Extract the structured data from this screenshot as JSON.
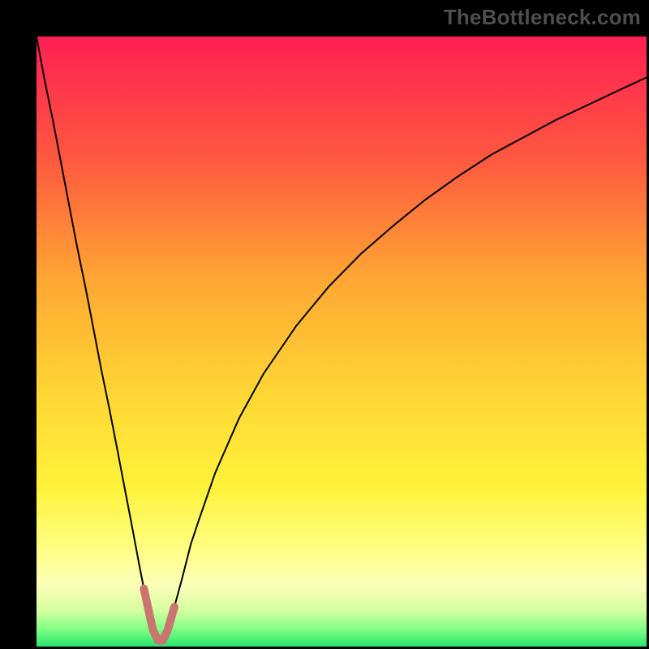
{
  "watermark": "TheBottleneck.com",
  "chart_data": {
    "type": "line",
    "title": "",
    "xlabel": "",
    "ylabel": "",
    "xlim": [
      0,
      100
    ],
    "ylim": [
      0,
      100
    ],
    "grid": false,
    "legend": false,
    "background_gradient": {
      "stops": [
        {
          "pos": 0.0,
          "color": "#ff1f53"
        },
        {
          "pos": 0.2,
          "color": "#ff5840"
        },
        {
          "pos": 0.4,
          "color": "#ffa733"
        },
        {
          "pos": 0.58,
          "color": "#ffd534"
        },
        {
          "pos": 0.74,
          "color": "#fff23b"
        },
        {
          "pos": 0.84,
          "color": "#ffff84"
        },
        {
          "pos": 0.9,
          "color": "#fbffb8"
        },
        {
          "pos": 0.94,
          "color": "#d6ffa0"
        },
        {
          "pos": 0.97,
          "color": "#86ff86"
        },
        {
          "pos": 1.0,
          "color": "#27e56b"
        }
      ]
    },
    "series": [
      {
        "name": "bottleneck-curve",
        "color": "#000000",
        "width": 2,
        "x": [
          0.0,
          1.3,
          2.7,
          4.0,
          5.3,
          6.6,
          8.0,
          9.3,
          10.6,
          12.0,
          13.3,
          14.6,
          15.6,
          16.8,
          17.6,
          18.6,
          19.1,
          19.9,
          20.7,
          21.5,
          22.6,
          23.9,
          25.3,
          26.6,
          29.3,
          33.2,
          37.2,
          42.6,
          47.9,
          53.2,
          58.5,
          63.8,
          69.0,
          74.5,
          79.7,
          85.1,
          90.4,
          95.7,
          100.0
        ],
        "y": [
          100.0,
          93.0,
          86.2,
          79.4,
          72.6,
          65.8,
          59.0,
          52.3,
          45.5,
          38.7,
          32.0,
          25.2,
          20.0,
          13.6,
          9.5,
          4.9,
          2.7,
          1.0,
          1.0,
          2.7,
          6.5,
          11.3,
          16.8,
          20.7,
          28.5,
          37.4,
          44.7,
          52.6,
          59.0,
          64.4,
          69.0,
          73.3,
          77.0,
          80.6,
          83.4,
          86.3,
          88.8,
          91.3,
          93.3
        ]
      },
      {
        "name": "bottleneck-highlight",
        "color": "#c9746f",
        "width": 10,
        "linecap": "round",
        "x": [
          17.6,
          18.6,
          19.1,
          19.9,
          20.7,
          21.5,
          22.6
        ],
        "y": [
          9.5,
          4.9,
          2.7,
          1.0,
          1.0,
          2.7,
          6.5
        ]
      }
    ]
  }
}
